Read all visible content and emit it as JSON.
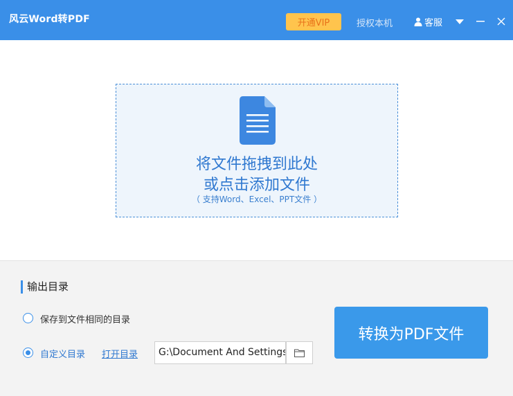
{
  "window": {
    "title": "风云Word转PDF",
    "vip_label": "开通VIP",
    "auth_label": "授权本机",
    "service_label": "客服",
    "icons": {
      "user": "user-icon",
      "menu": "dropdown-menu-icon",
      "minimize": "minimize-icon",
      "close": "close-icon"
    }
  },
  "drop_zone": {
    "line1": "将文件拖拽到此处",
    "line2": "或点击添加文件",
    "hint": "（ 支持Word、Excel、PPT文件 ）",
    "icon": "document-icon"
  },
  "output": {
    "section_title": "输出目录",
    "option_same_dir": "保存到文件相同的目录",
    "option_custom": "自定义目录",
    "selected": "自定义目录",
    "open_dir_label": "打开目录",
    "path_value": "G:\\Document And Settings",
    "folder_icon": "folder-icon"
  },
  "convert_button": "转换为PDF文件",
  "colors": {
    "accent": "#3a8fe8",
    "vip_bg": "#ffc44d",
    "vip_text": "#e8721a"
  }
}
